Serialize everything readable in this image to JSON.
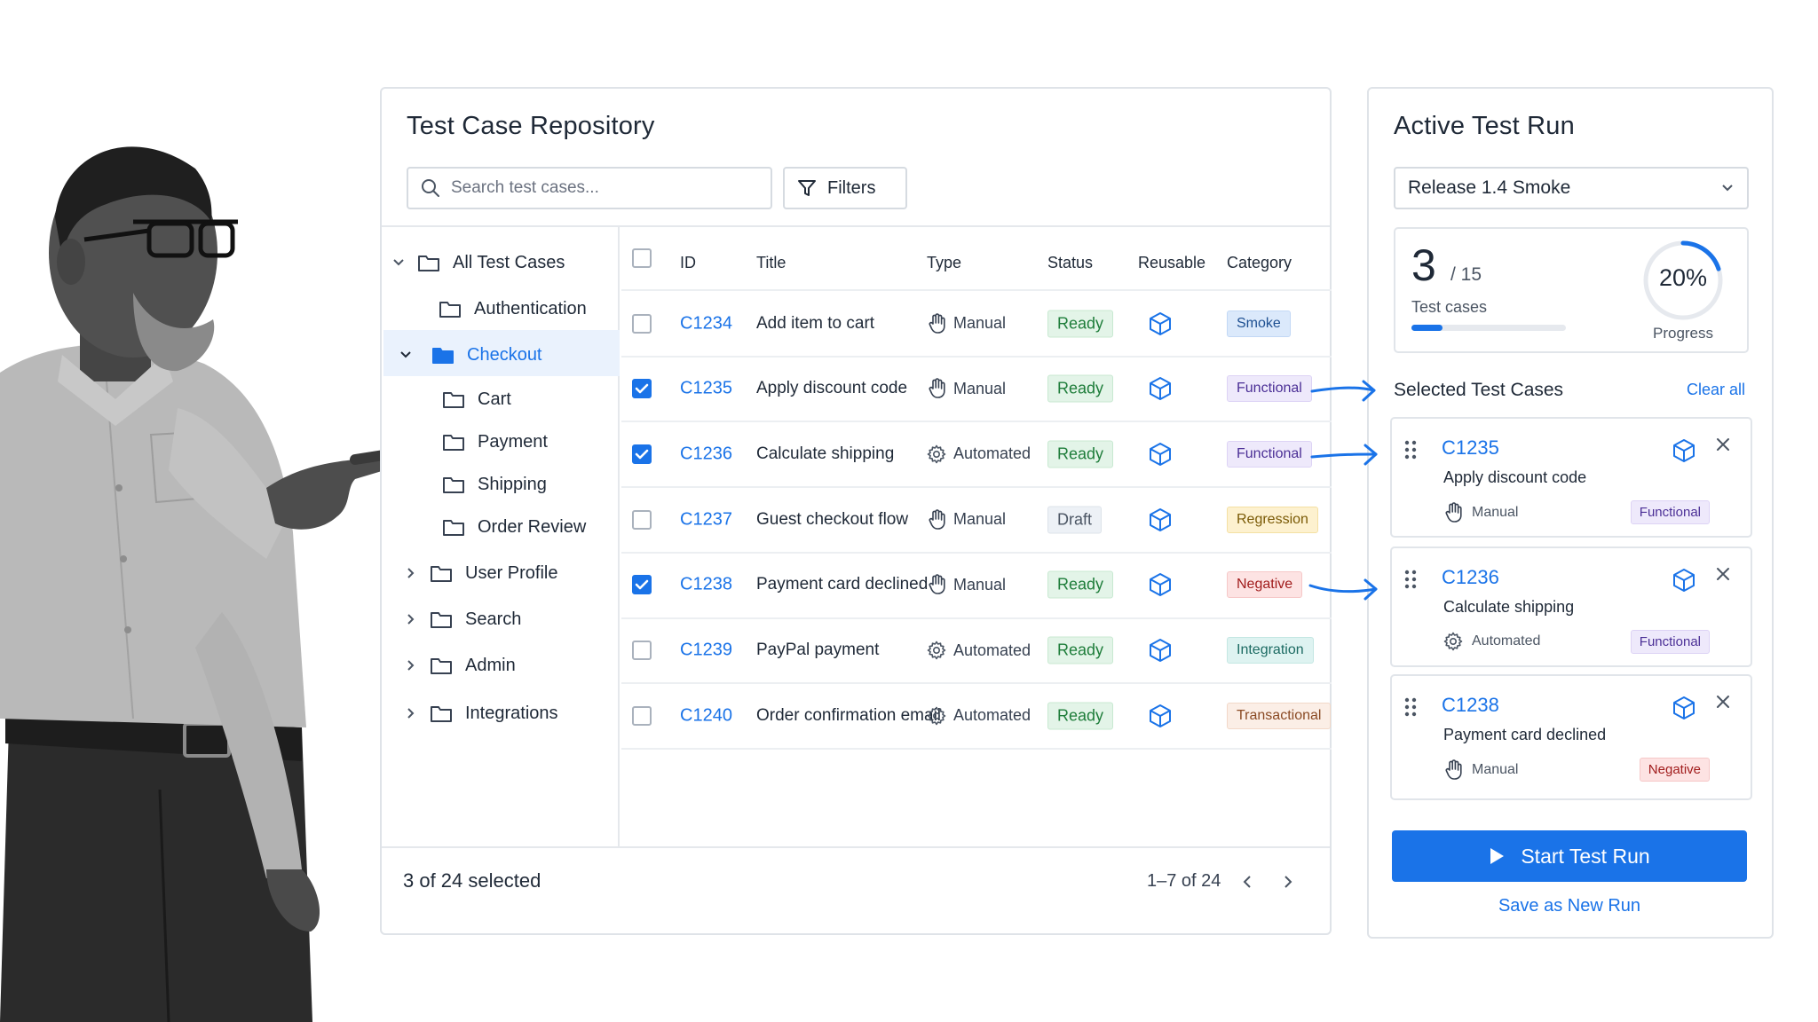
{
  "repo": {
    "title": "Test Case Repository",
    "search_placeholder": "Search test cases...",
    "filters_label": "Filters",
    "tree": [
      {
        "label": "All Test Cases",
        "expanded": true
      },
      {
        "label": "Authentication"
      },
      {
        "label": "Checkout",
        "expanded": true,
        "selected": true
      },
      {
        "label": "Cart"
      },
      {
        "label": "Payment"
      },
      {
        "label": "Shipping"
      },
      {
        "label": "Order Review"
      },
      {
        "label": "User Profile"
      },
      {
        "label": "Search"
      },
      {
        "label": "Admin"
      },
      {
        "label": "Integrations"
      }
    ],
    "columns": {
      "id": "ID",
      "title": "Title",
      "type": "Type",
      "status": "Status",
      "reusable": "Reusable",
      "category": "Category"
    },
    "rows": [
      {
        "checked": false,
        "id": "C1234",
        "title": "Add item to cart",
        "type": "Manual",
        "type_icon": "hand-icon",
        "status": "Ready",
        "category": "Smoke"
      },
      {
        "checked": true,
        "id": "C1235",
        "title": "Apply discount code",
        "type": "Manual",
        "type_icon": "hand-icon",
        "status": "Ready",
        "category": "Functional"
      },
      {
        "checked": true,
        "id": "C1236",
        "title": "Calculate shipping",
        "type": "Automated",
        "type_icon": "gear-icon",
        "status": "Ready",
        "category": "Functional"
      },
      {
        "checked": false,
        "id": "C1237",
        "title": "Guest checkout flow",
        "type": "Manual",
        "type_icon": "hand-icon",
        "status": "Draft",
        "category": "Regression"
      },
      {
        "checked": true,
        "id": "C1238",
        "title": "Payment card declined",
        "type": "Manual",
        "type_icon": "hand-icon",
        "status": "Ready",
        "category": "Negative"
      },
      {
        "checked": false,
        "id": "C1239",
        "title": "PayPal payment",
        "type": "Automated",
        "type_icon": "gear-icon",
        "status": "Ready",
        "category": "Integration"
      },
      {
        "checked": false,
        "id": "C1240",
        "title": "Order confirmation email",
        "type": "Automated",
        "type_icon": "gear-icon",
        "status": "Ready",
        "category": "Transactional"
      }
    ],
    "footer": {
      "selected_text": "3 of 24 selected",
      "range_text": "1–7 of 24"
    }
  },
  "run": {
    "title": "Active Test Run",
    "select_value": "Release 1.4 Smoke",
    "count": "3",
    "total": "/ 15",
    "count_label": "Test cases",
    "progress_pct": "20%",
    "progress_fraction": 0.2,
    "progress_label": "Progress",
    "selected_title": "Selected Test Cases",
    "clear_all": "Clear all",
    "selected": [
      {
        "id": "C1235",
        "title": "Apply discount code",
        "type": "Manual",
        "category": "Functional"
      },
      {
        "id": "C1236",
        "title": "Calculate shipping",
        "type": "Automated",
        "category": "Functional"
      },
      {
        "id": "C1238",
        "title": "Payment card declined",
        "type": "Manual",
        "category": "Negative"
      }
    ],
    "start_label": "Start Test Run",
    "save_label": "Save as New Run"
  },
  "colors": {
    "accent": "#1a73e8",
    "ready": "#1e7d3a",
    "cat_smoke": "#dbe9fb",
    "cat_functional": "#ede8fb",
    "cat_regression": "#fdf1cf",
    "cat_negative": "#fde3e3",
    "cat_integration": "#def3f1",
    "cat_transactional": "#fbeee6"
  }
}
